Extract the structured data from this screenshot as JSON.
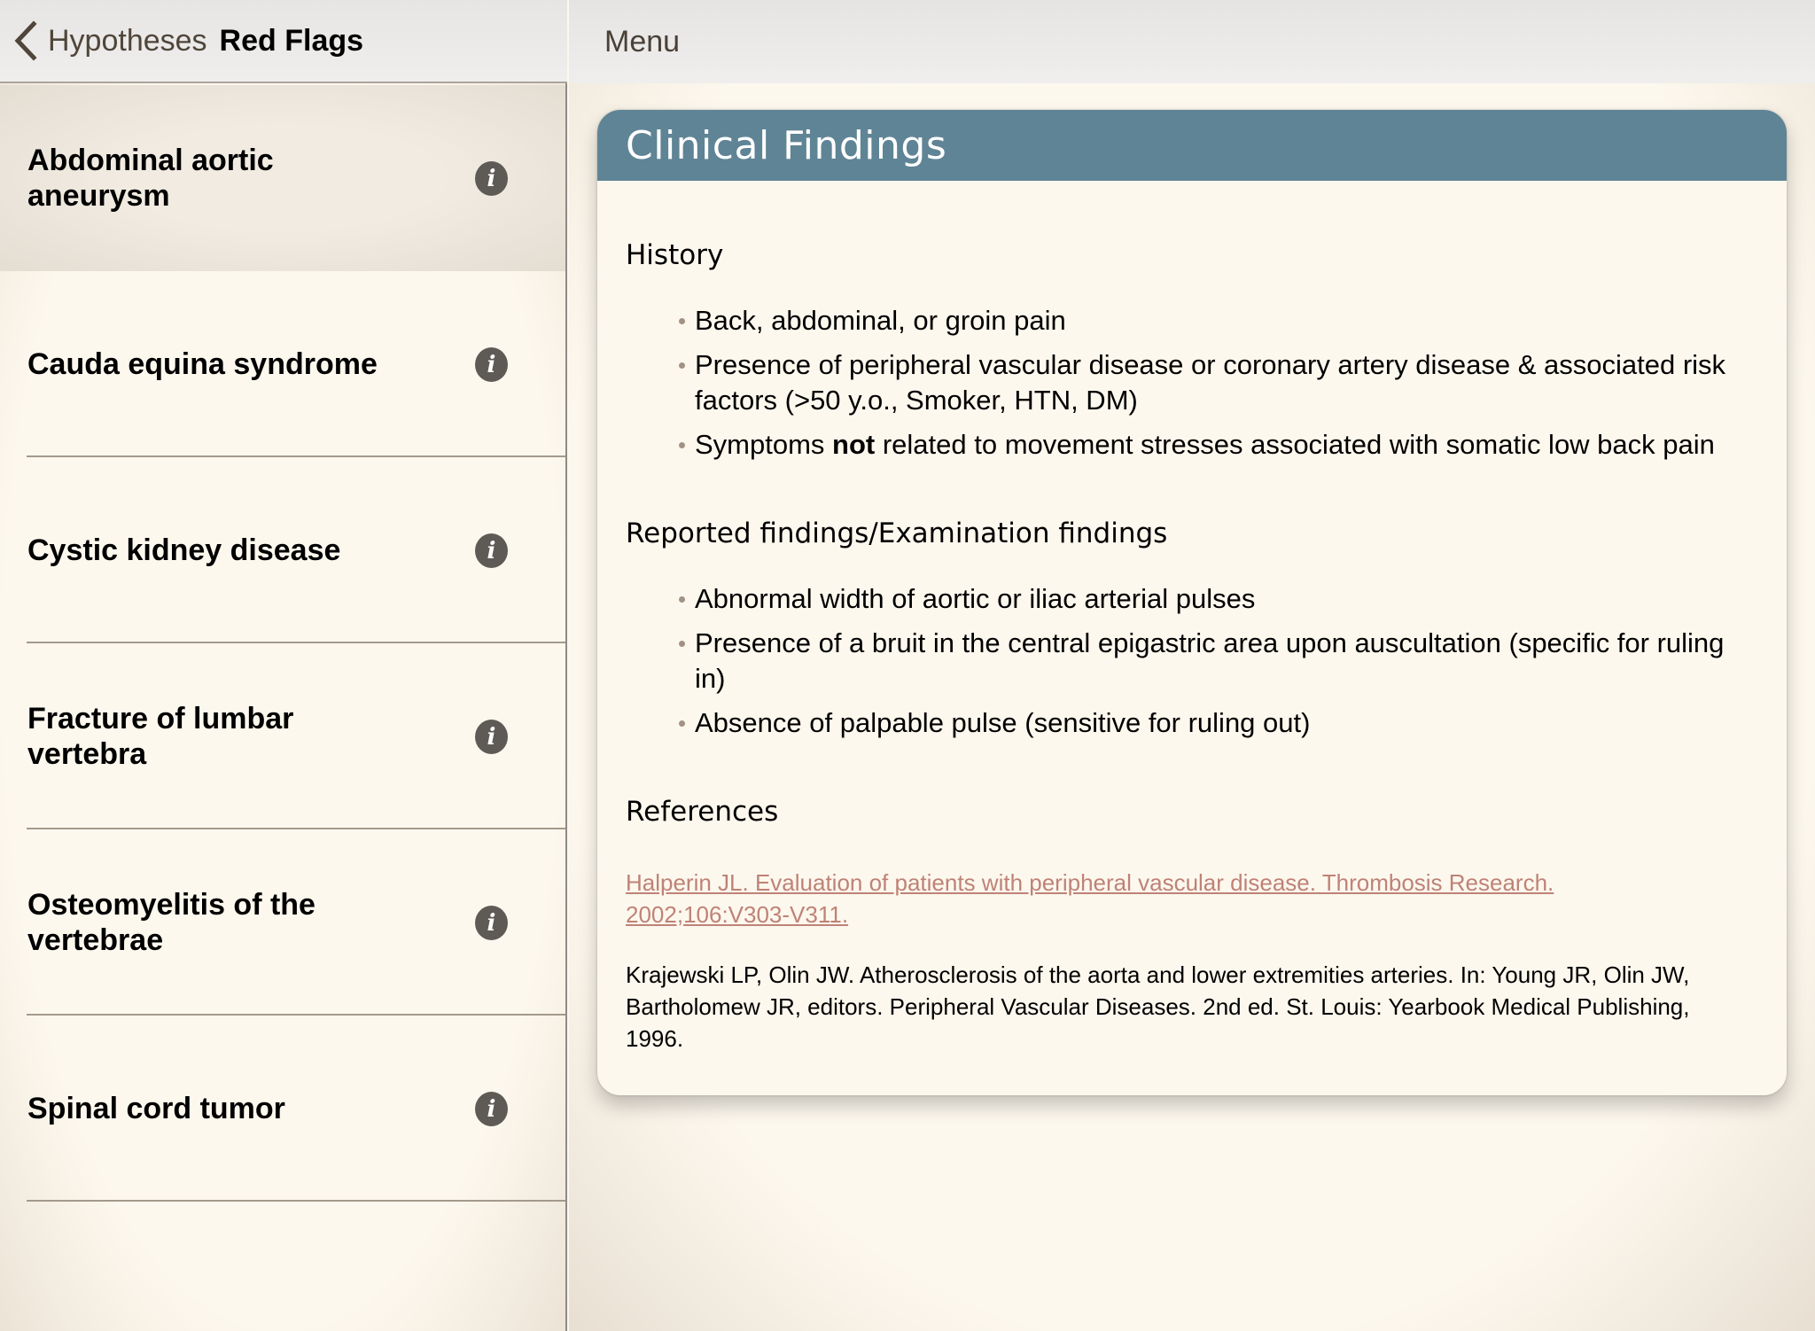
{
  "sidebar": {
    "back_label": "Hypotheses",
    "title": "Red Flags",
    "items": [
      {
        "label": "Abdominal aortic aneurysm",
        "selected": true,
        "icon": "info-icon"
      },
      {
        "label": "Cauda equina syndrome",
        "selected": false,
        "icon": "info-icon"
      },
      {
        "label": "Cystic kidney disease",
        "selected": false,
        "icon": "info-icon"
      },
      {
        "label": "Fracture of lumbar vertebra",
        "selected": false,
        "icon": "info-icon"
      },
      {
        "label": "Osteomyelitis of the vertebrae",
        "selected": false,
        "icon": "info-icon"
      },
      {
        "label": "Spinal cord tumor",
        "selected": false,
        "icon": "info-icon"
      }
    ],
    "info_glyph": "i"
  },
  "main": {
    "menu_label": "Menu",
    "card": {
      "title": "Clinical Findings",
      "header_color": "#5f8495",
      "sections": {
        "history": {
          "heading": "History",
          "bullets": [
            "Back, abdominal, or groin pain",
            "Presence of peripheral vascular disease or coronary artery disease & associated risk factors (>50 y.o., Smoker, HTN, DM)",
            {
              "before": "Symptoms ",
              "bold": "not",
              "after": " related to movement stresses associated with somatic low back pain"
            }
          ]
        },
        "exam": {
          "heading": "Reported findings/Examination findings",
          "bullets": [
            "Abnormal width of aortic or iliac arterial pulses",
            "Presence of a bruit in the central epigastric area upon auscultation (specific for ruling in)",
            "Absence of palpable pulse (sensitive for ruling out)"
          ]
        },
        "references": {
          "heading": "References",
          "link": "Halperin JL. Evaluation of patients with peripheral vascular disease. Thrombosis Research. 2002;106:V303-V311.",
          "link_color": "#bf8277",
          "text": "Krajewski LP, Olin JW. Atherosclerosis of the aorta and lower extremities arteries. In: Young JR, Olin JW, Bartholomew JR, editors. Peripheral Vascular Diseases. 2nd ed. St. Louis: Yearbook Medical Publishing, 1996."
        }
      }
    }
  }
}
